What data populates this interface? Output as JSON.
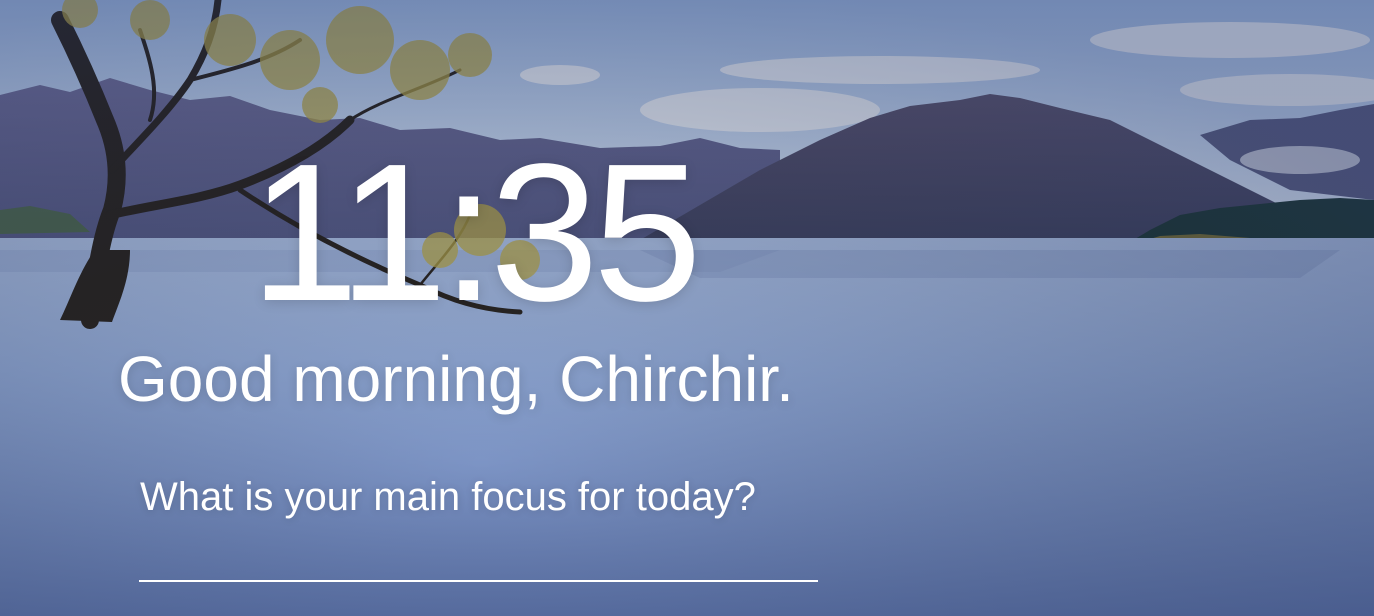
{
  "clock": {
    "time": "11:35"
  },
  "greeting": {
    "text": "Good morning, Chirchir."
  },
  "focus": {
    "prompt": "What is your main focus for today?",
    "value": "",
    "placeholder": ""
  },
  "colors": {
    "text": "#ffffff",
    "sky_top": "#a9c4ec",
    "lake": "#7f98c8"
  }
}
